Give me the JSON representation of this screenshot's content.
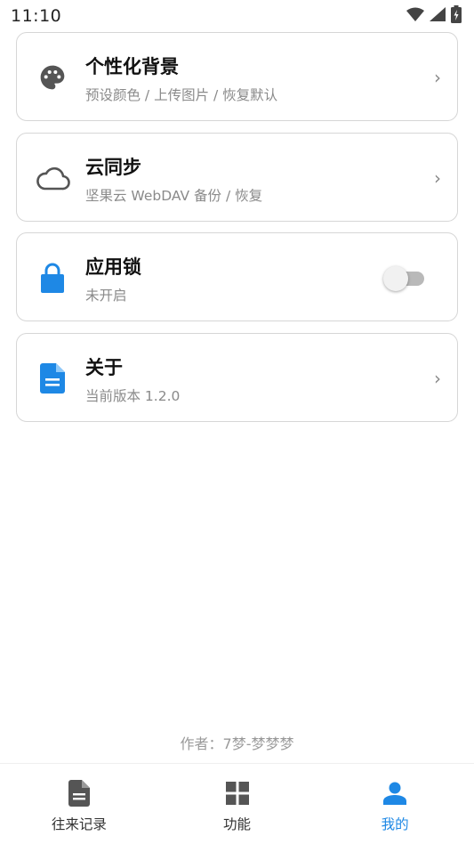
{
  "status_bar": {
    "time": "11:10",
    "icons": [
      "wifi-icon",
      "cell-signal-icon",
      "battery-charging-icon"
    ]
  },
  "settings": [
    {
      "id": "background",
      "icon": "palette-icon",
      "title": "个性化背景",
      "subtitle": "预设颜色 / 上传图片 / 恢复默认",
      "control": "chevron"
    },
    {
      "id": "cloud-sync",
      "icon": "cloud-icon",
      "title": "云同步",
      "subtitle": "坚果云 WebDAV 备份 / 恢复",
      "control": "chevron"
    },
    {
      "id": "app-lock",
      "icon": "lock-icon",
      "title": "应用锁",
      "subtitle": "未开启",
      "control": "toggle",
      "enabled": false
    },
    {
      "id": "about",
      "icon": "document-icon",
      "title": "关于",
      "subtitle": "当前版本 1.2.0",
      "control": "chevron"
    }
  ],
  "chevron_glyph": "›",
  "footer": {
    "author": "作者：7梦-梦梦梦"
  },
  "bottom_nav": {
    "items": [
      {
        "label": "往来记录",
        "icon": "document-icon",
        "active": false
      },
      {
        "label": "功能",
        "icon": "grid-icon",
        "active": false
      },
      {
        "label": "我的",
        "icon": "person-icon",
        "active": true
      }
    ]
  },
  "colors": {
    "accent": "#1e88e5",
    "icon_gray": "#555555",
    "subtitle_gray": "#8a8a8a",
    "border": "#d6d6d6"
  }
}
